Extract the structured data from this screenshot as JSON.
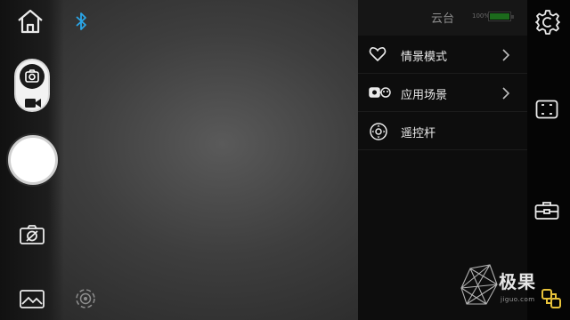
{
  "panel": {
    "title": "云台",
    "battery_percent_text": "100%",
    "battery_level": 1.0
  },
  "menu": [
    {
      "label": "情景模式",
      "icon": "heart-icon",
      "has_submenu": true
    },
    {
      "label": "应用场景",
      "icon": "camera-gimbal-icon",
      "has_submenu": true
    },
    {
      "label": "遥控杆",
      "icon": "joystick-icon",
      "has_submenu": false
    }
  ],
  "left_toolbar": {
    "icons": [
      "home-icon",
      "bluetooth-icon",
      "photo-mode-icon",
      "video-mode-icon",
      "shutter-button",
      "camera-off-icon",
      "gallery-icon",
      "focus-target-icon"
    ]
  },
  "right_toolbar": {
    "icons": [
      "settings-gear-icon",
      "frame-icon",
      "toolbox-icon",
      "link-icon"
    ]
  },
  "watermark": {
    "text": "极果",
    "subtext": "jiguo.com"
  },
  "colors": {
    "accent_bluetooth": "#2aa6e8",
    "battery_fill": "#1c6b1c",
    "watermark_link": "#e7c23a"
  }
}
